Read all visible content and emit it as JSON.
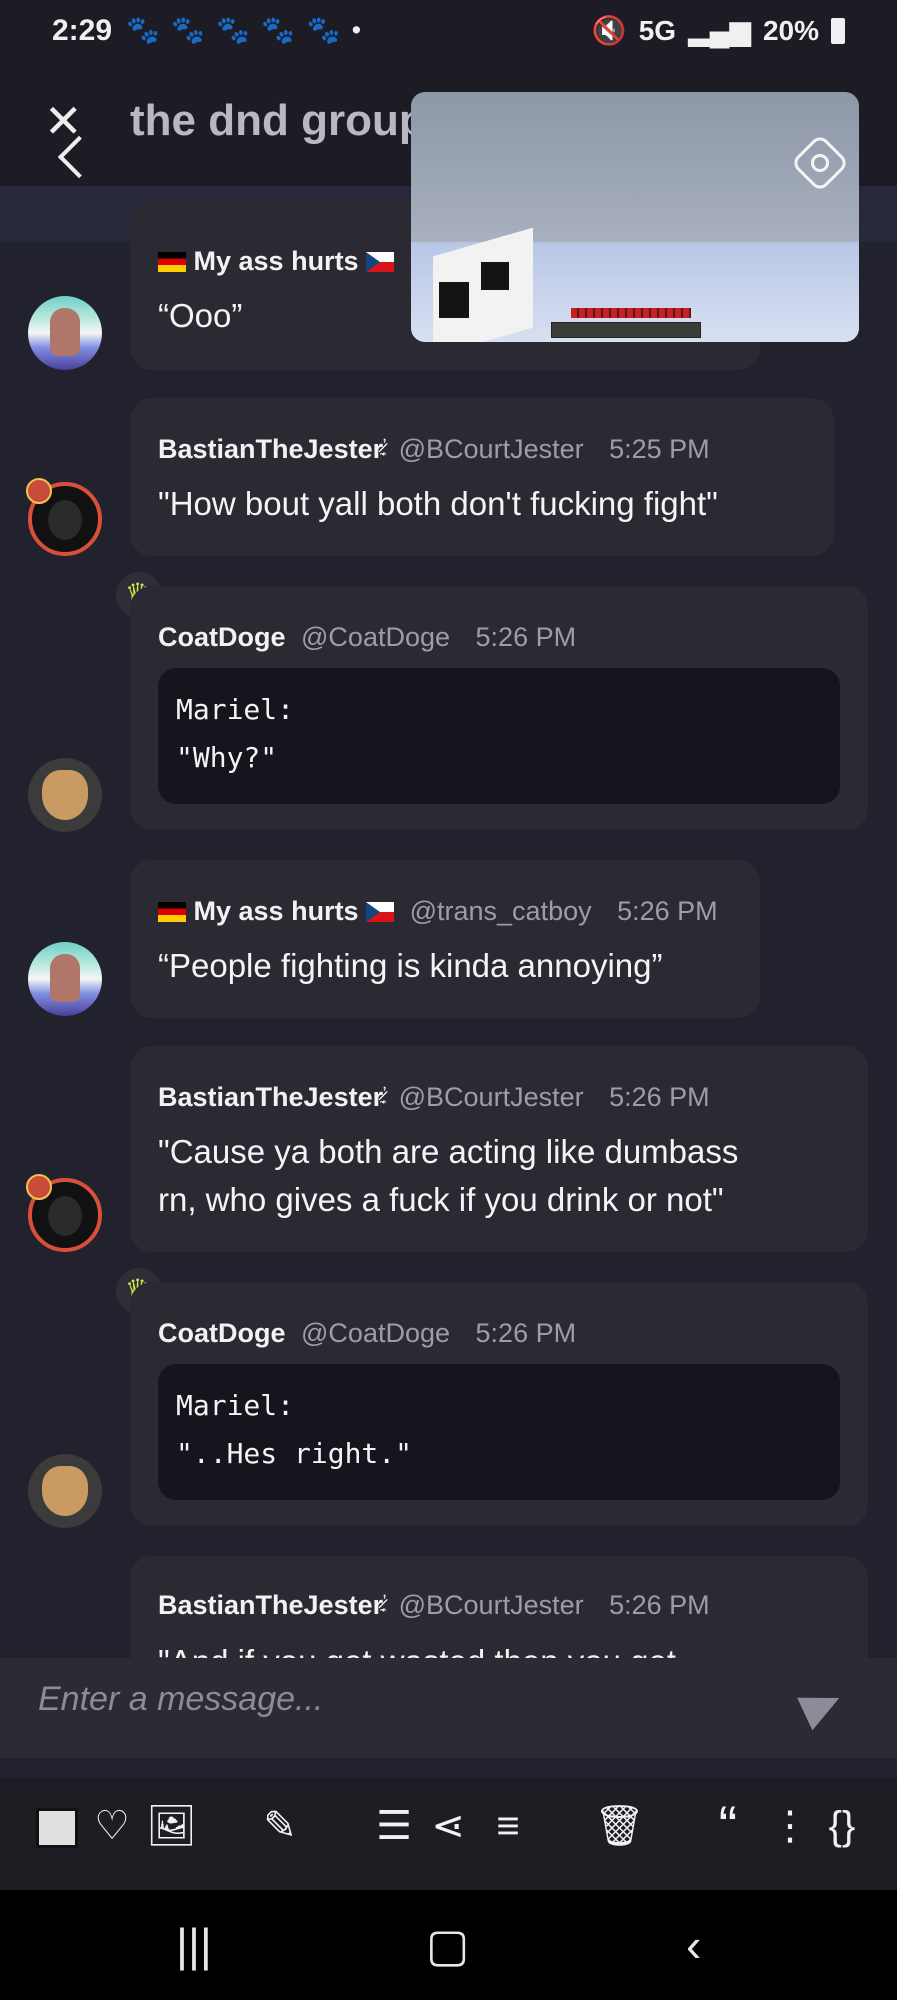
{
  "status_bar": {
    "time": "2:29",
    "notification_icons": "🐾 🐾 🐾 🐾 🐾 •",
    "signal_text": "5G",
    "battery": "20%"
  },
  "header": {
    "title": "the dnd group"
  },
  "messages": [
    {
      "author": "My ass hurts",
      "handle": "",
      "time": "",
      "text": "“Ooo”"
    },
    {
      "author": "BastianTheJester",
      "handle": "@BCourtJester",
      "time": "5:25 PM",
      "text": "\"How bout yall both don't fucking fight\""
    },
    {
      "author": "CoatDoge",
      "handle": "@CoatDoge",
      "time": "5:26 PM",
      "code_lines": [
        "Mariel:",
        "\"Why?\""
      ]
    },
    {
      "author": "My ass hurts",
      "handle": "@trans_catboy",
      "time": "5:26 PM",
      "text": "“People fighting is kinda annoying”"
    },
    {
      "author": "BastianTheJester",
      "handle": "@BCourtJester",
      "time": "5:26 PM",
      "text_lines": [
        "\"Cause ya both are acting like dumbass",
        "rn, who gives a fuck if you drink or not\""
      ]
    },
    {
      "author": "CoatDoge",
      "handle": "@CoatDoge",
      "time": "5:26 PM",
      "code_lines": [
        "Mariel:",
        "\"..Hes right.\""
      ]
    },
    {
      "author": "BastianTheJester",
      "handle": "@BCourtJester",
      "time": "5:26 PM",
      "text": "\"And if you get wasted then you get"
    }
  ],
  "composer": {
    "placeholder": "Enter a message..."
  },
  "toolbar": {
    "quote_glyph": "“",
    "braces_glyph": "{}"
  },
  "icons": [
    "close-icon",
    "back-icon",
    "rotate-icon",
    "send-icon",
    "heart-icon",
    "image-icon",
    "edit-icon",
    "bullet-list-icon",
    "share-icon",
    "numbered-list-icon",
    "trash-icon",
    "quote-icon",
    "more-icon",
    "code-icon"
  ]
}
